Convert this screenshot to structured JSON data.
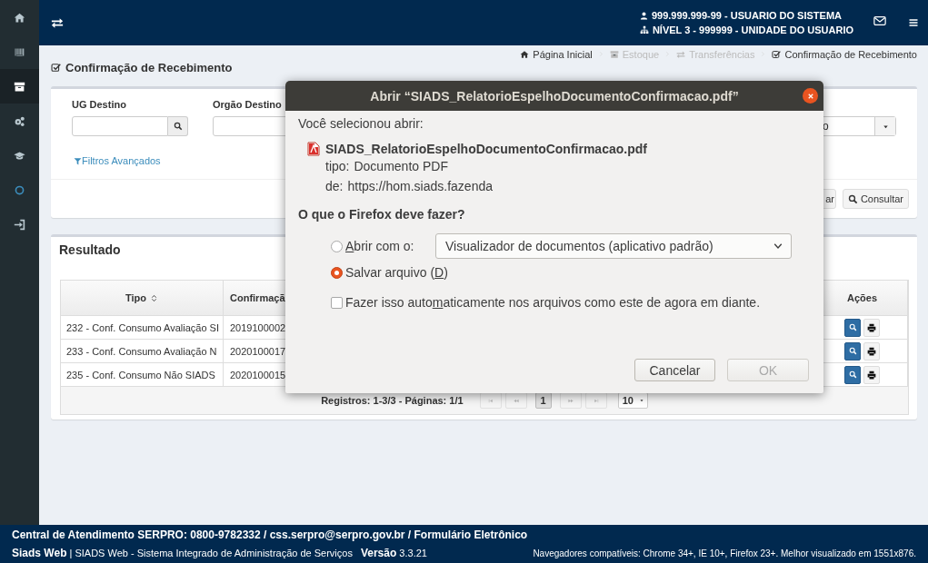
{
  "sidebar": {
    "items": [
      {
        "selected": false
      },
      {
        "selected": false
      },
      {
        "selected": true
      },
      {
        "selected": false
      },
      {
        "selected": false
      },
      {
        "selected": false
      },
      {
        "selected": false
      }
    ]
  },
  "topbar": {
    "user": "999.999.999-99 - USUARIO DO SISTEMA",
    "unit": "NÍVEL 3 - 999999 - UNIDADE DO USUARIO"
  },
  "page_title": "Confirmação de Recebimento",
  "breadcrumb": [
    {
      "label": "Página Inicial",
      "disabled": false
    },
    {
      "label": "Estoque",
      "disabled": true
    },
    {
      "label": "Transferências",
      "disabled": true
    },
    {
      "label": "Confirmação de Recebimento",
      "disabled": false
    }
  ],
  "filters": {
    "fields": [
      {
        "label": "UG Destino",
        "kind": "lookup"
      },
      {
        "label": "Orgão Destino",
        "kind": "text"
      }
    ],
    "select_value": "o",
    "advanced_link": "Filtros Avançados",
    "buttons": [
      "ar",
      "Consultar"
    ]
  },
  "results": {
    "title": "Resultado",
    "columns": [
      "Tipo",
      "Confirmaçã",
      "Ações"
    ],
    "rows": [
      {
        "tipo": "232 - Conf. Consumo Avaliação SI",
        "confirmacao": "2019100002"
      },
      {
        "tipo": "233 - Conf. Consumo Avaliação N",
        "confirmacao": "2020100017"
      },
      {
        "tipo": "235 - Conf. Consumo Não SIADS",
        "confirmacao": "2020100015"
      }
    ],
    "pagination": {
      "summary": "Registros: 1-3/3 - Páginas: 1/1",
      "controls": [
        {
          "kind": "first",
          "disabled": true
        },
        {
          "kind": "prev",
          "disabled": true
        },
        {
          "kind": "page",
          "label": "1",
          "selected": true
        },
        {
          "kind": "next",
          "disabled": true
        },
        {
          "kind": "last",
          "disabled": true
        }
      ],
      "page_size": "10"
    }
  },
  "dialog": {
    "title": "Abrir “SIADS_RelatorioEspelhoDocumentoConfirmacao.pdf”",
    "intro": "Você selecionou abrir:",
    "filename": "SIADS_RelatorioEspelhoDocumentoConfirmacao.pdf",
    "details": [
      {
        "label": "tipo:",
        "value": "Documento PDF"
      },
      {
        "label": "de:",
        "value": "https://hom.siads.fazenda"
      }
    ],
    "question": "O que o Firefox deve fazer?",
    "options": [
      {
        "label": {
          "key": "A",
          "after": "brir com o:"
        },
        "selected": false,
        "app": "Visualizador de documentos (aplicativo padrão)"
      },
      {
        "label": {
          "before": "Salvar arquivo (",
          "key": "D",
          "after": ")"
        },
        "selected": true
      }
    ],
    "checkbox": {
      "label": {
        "before": "Fazer isso auto",
        "key": "m",
        "after": "aticamente nos arquivos como este de agora em diante."
      },
      "checked": false
    },
    "buttons": [
      {
        "label": "Cancelar",
        "disabled": false
      },
      {
        "label": "OK",
        "disabled": true
      }
    ]
  },
  "footer": {
    "contact": "Central de Atendimento SERPRO: 0800-9782332 / css.serpro@serpro.gov.br / Formulário Eletrônico",
    "system": "**Siads Web** | SIADS Web - Sistema Integrado de Administração de Serviços",
    "version": "**Versão** 3.3.21",
    "browsers": "Navegadores compatíveis: Chrome 34+, IE 10+, Firefox 23+. Melhor visualizado em 1551x876."
  }
}
